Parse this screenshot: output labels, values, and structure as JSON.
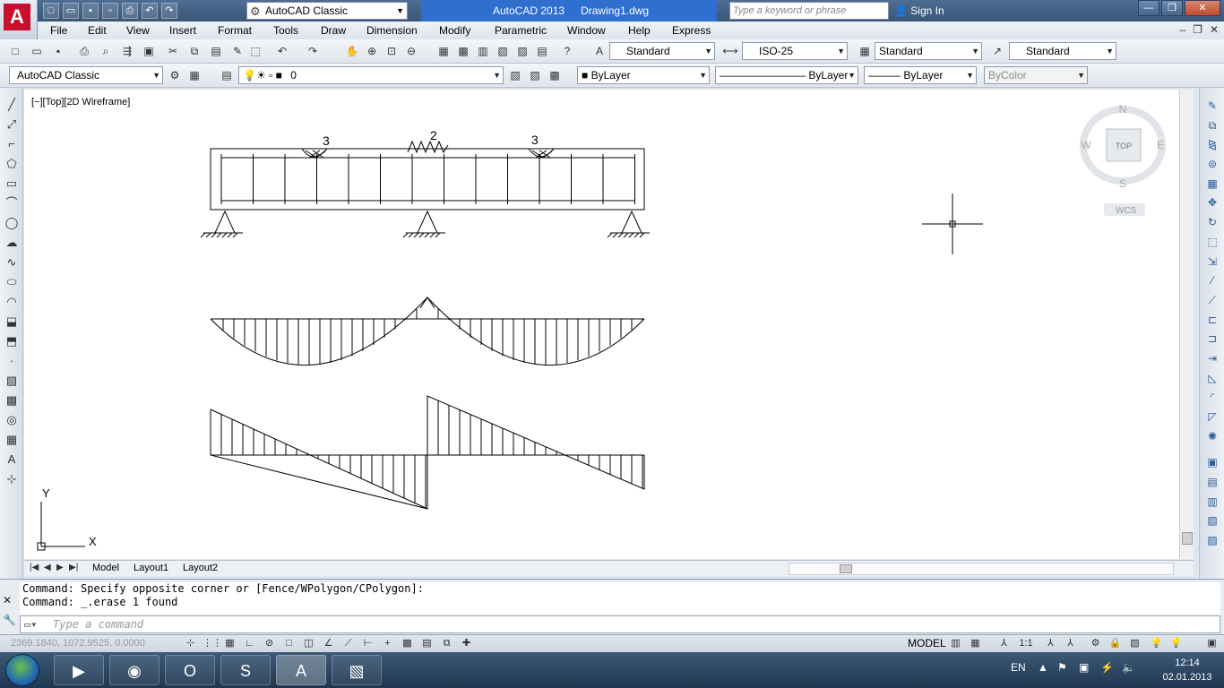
{
  "title_bar": {
    "workspace": "AutoCAD Classic",
    "app_title": "AutoCAD 2013",
    "document": "Drawing1.dwg",
    "search_placeholder": "Type a keyword or phrase",
    "sign_in": "Sign In"
  },
  "menu": [
    "File",
    "Edit",
    "View",
    "Insert",
    "Format",
    "Tools",
    "Draw",
    "Dimension",
    "Modify",
    "Parametric",
    "Window",
    "Help",
    "Express"
  ],
  "styles_toolbar": {
    "text_style": "Standard",
    "dim_style": "ISO-25",
    "table_style": "Standard",
    "multileader_style": "Standard"
  },
  "layers_toolbar": {
    "workspace": "AutoCAD Classic",
    "layer": "0",
    "color": "ByLayer",
    "linetype": "ByLayer",
    "lineweight": "ByLayer",
    "plotstyle": "ByColor"
  },
  "viewport": {
    "label": "[−][Top][2D Wireframe]",
    "viewcube": {
      "north": "N",
      "south": "S",
      "east": "E",
      "west": "W",
      "face": "TOP",
      "ucs": "WCS"
    },
    "ucs_icon": {
      "y": "Y",
      "x": "X"
    },
    "beam_labels": [
      "3",
      "2",
      "3"
    ]
  },
  "tabs": [
    "Model",
    "Layout1",
    "Layout2"
  ],
  "command_line": {
    "history": [
      "Command: Specify opposite corner or [Fence/WPolygon/CPolygon]:",
      "Command: _.erase 1 found"
    ],
    "placeholder": "Type a command"
  },
  "status_bar": {
    "coordinates": "2369.1840, 1072.9525, 0.0000",
    "space": "MODEL",
    "scale": "1:1"
  },
  "taskbar": {
    "language": "EN",
    "time": "12:14",
    "date": "02.01.2013"
  }
}
